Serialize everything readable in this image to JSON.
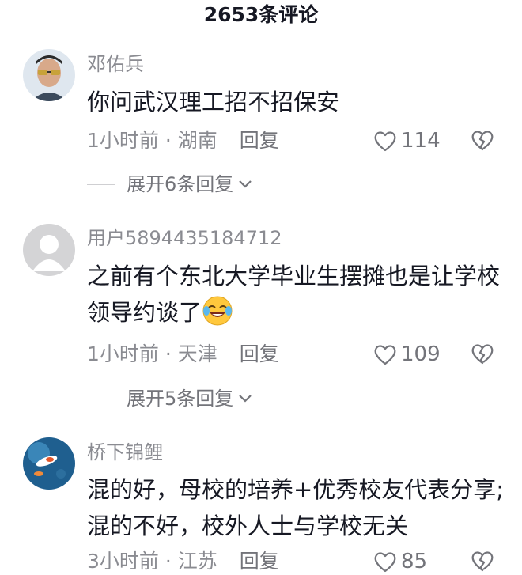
{
  "header": {
    "title": "2653条评论"
  },
  "comments": [
    {
      "username": "邓佑兵",
      "text": "你问武汉理工招不招保安",
      "time": "1小时前",
      "location": "湖南",
      "reply_label": "回复",
      "likes": "114",
      "expand_label": "展开6条回复"
    },
    {
      "username": "用户5894435184712",
      "text": "之前有个东北大学毕业生摆摊也是让学校领导约谈了",
      "emoji": "crying-laughing-emoji",
      "time": "1小时前",
      "location": "天津",
      "reply_label": "回复",
      "likes": "109",
      "expand_label": "展开5条回复"
    },
    {
      "username": "桥下锦鲤",
      "text": "混的好，母校的培养+优秀校友代表分享;混的不好，校外人士与学校无关",
      "time": "3小时前",
      "location": "江苏",
      "reply_label": "回复",
      "likes": "85"
    }
  ],
  "colors": {
    "meta": "#8a8b91",
    "text": "#161823",
    "emoji": "#ffc83d"
  },
  "meta_separator": " · "
}
